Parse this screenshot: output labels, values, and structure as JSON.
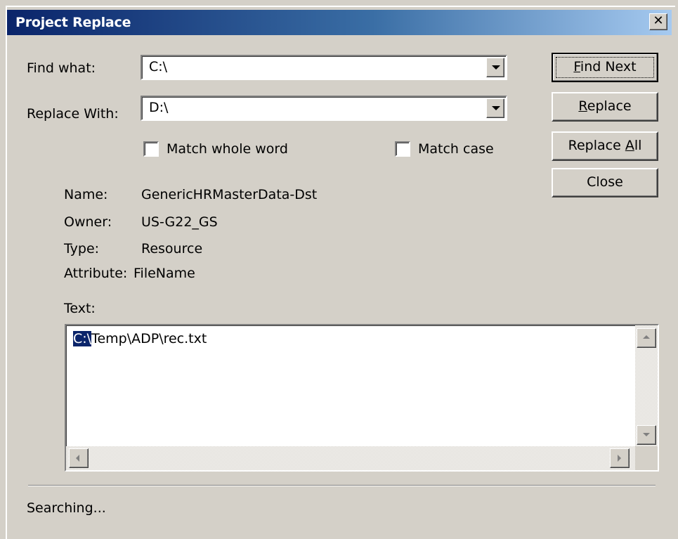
{
  "window": {
    "title": "Project Replace",
    "close_glyph": "✕"
  },
  "find": {
    "label": "Find what:",
    "value": "C:\\"
  },
  "replace": {
    "label": "Replace With:",
    "value": "D:\\"
  },
  "options": {
    "match_whole_word": {
      "label": "Match whole word",
      "checked": false
    },
    "match_case": {
      "label": "Match case",
      "checked": false
    }
  },
  "buttons": {
    "find_next": {
      "prefix": "",
      "accel": "F",
      "suffix": "ind Next"
    },
    "replace": {
      "prefix": "",
      "accel": "R",
      "suffix": "eplace"
    },
    "replace_all": {
      "prefix": "Replace ",
      "accel": "A",
      "suffix": "ll"
    },
    "close": "Close"
  },
  "info": {
    "name_label": "Name:",
    "name_value": "GenericHRMasterData-Dst",
    "owner_label": "Owner:",
    "owner_value": "US-G22_GS",
    "type_label": "Type:",
    "type_value": "Resource",
    "attribute_label": "Attribute:",
    "attribute_value": "FileName"
  },
  "text_area": {
    "label": "Text:",
    "selected": "C:\\",
    "rest": "Temp\\ADP\\rec.txt"
  },
  "status": "Searching..."
}
